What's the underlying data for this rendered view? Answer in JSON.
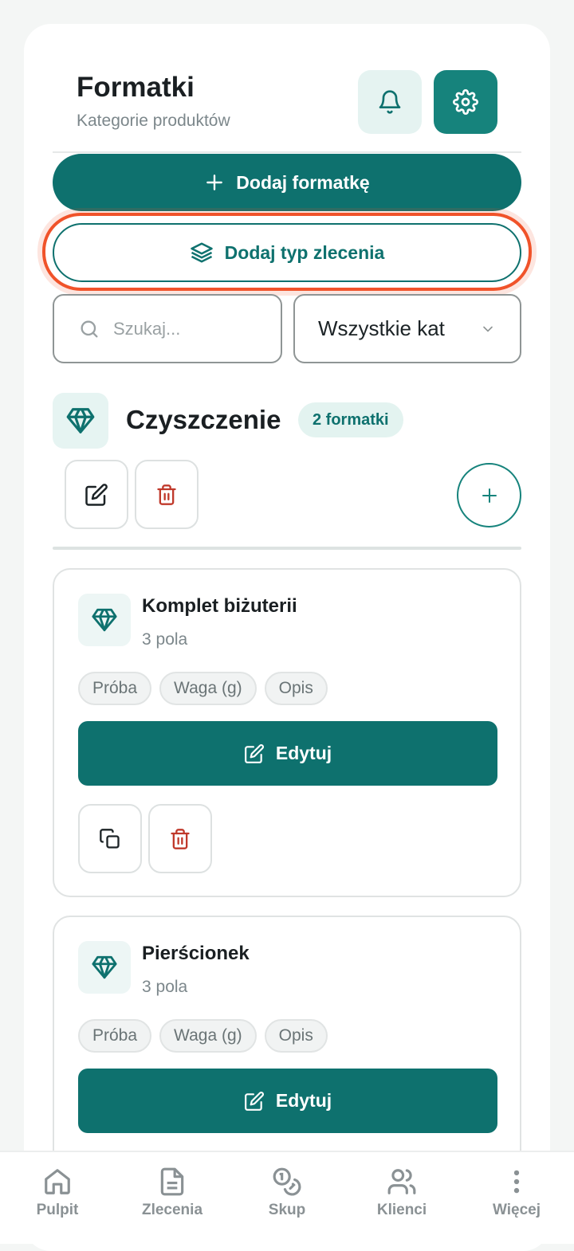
{
  "header": {
    "title": "Formatki",
    "subtitle": "Kategorie produktów"
  },
  "actions": {
    "add_template": "Dodaj formatkę",
    "add_order_type": "Dodaj typ zlecenia"
  },
  "search": {
    "placeholder": "Szukaj...",
    "value": ""
  },
  "filter": {
    "selected": "Wszystkie kat"
  },
  "category": {
    "name": "Czyszczenie",
    "count_label": "2 formatki",
    "icon": "diamond-icon"
  },
  "items": [
    {
      "name": "Komplet biżuterii",
      "fields_label": "3 pola",
      "tags": [
        "Próba",
        "Waga (g)",
        "Opis"
      ],
      "edit_label": "Edytuj"
    },
    {
      "name": "Pierścionek",
      "fields_label": "3 pola",
      "tags": [
        "Próba",
        "Waga (g)",
        "Opis"
      ],
      "edit_label": "Edytuj"
    }
  ],
  "nav": {
    "items": [
      {
        "label": "Pulpit",
        "icon": "home-icon"
      },
      {
        "label": "Zlecenia",
        "icon": "document-icon"
      },
      {
        "label": "Skup",
        "icon": "coins-icon"
      },
      {
        "label": "Klienci",
        "icon": "users-icon"
      },
      {
        "label": "Więcej",
        "icon": "more-vertical-icon"
      }
    ]
  },
  "colors": {
    "primary": "#0e716e",
    "accent_light": "#e5f3f1",
    "danger": "#c0392b",
    "highlight": "#f0532a"
  }
}
